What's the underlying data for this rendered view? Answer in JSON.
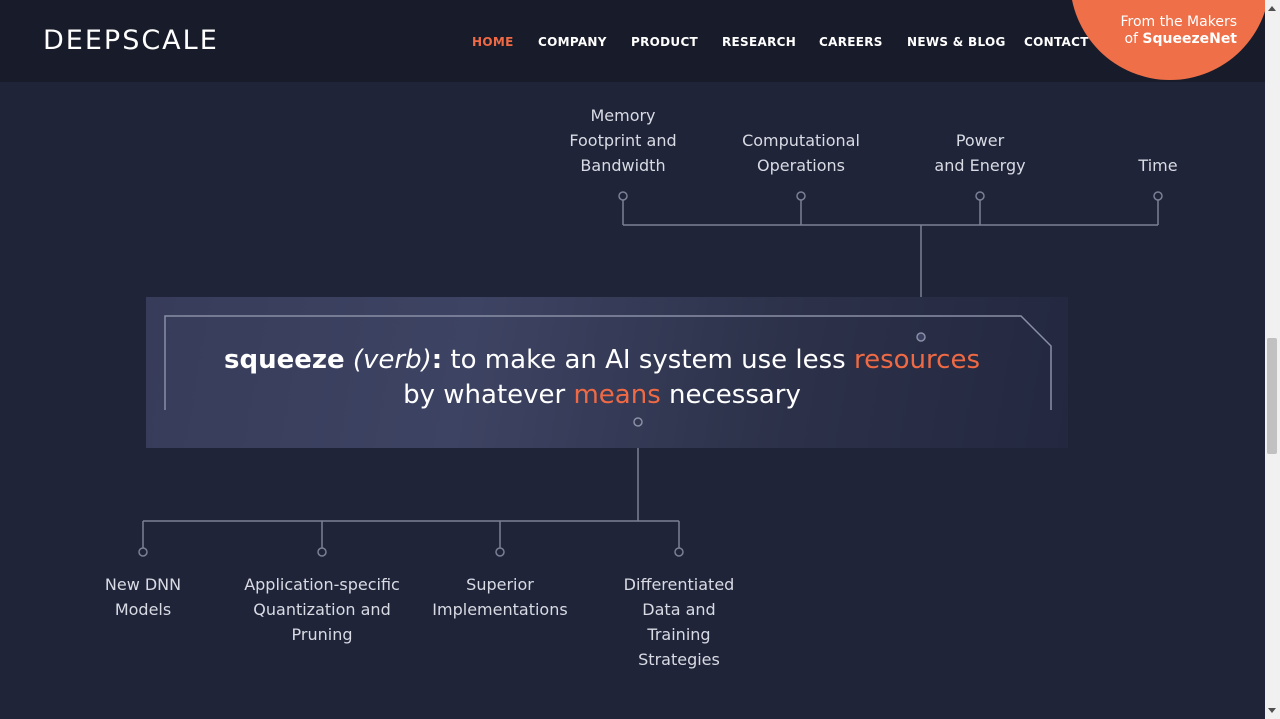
{
  "header": {
    "logo": "DEEPSCALE",
    "nav": [
      {
        "label": "HOME",
        "active": true
      },
      {
        "label": "COMPANY"
      },
      {
        "label": "PRODUCT"
      },
      {
        "label": "RESEARCH"
      },
      {
        "label": "CAREERS"
      },
      {
        "label": "NEWS & BLOG"
      },
      {
        "label": "CONTACT"
      }
    ],
    "badge": {
      "line1": "From the Makers",
      "line2_prefix": "of ",
      "line2_bold": "SqueezeNet"
    }
  },
  "top_labels": [
    {
      "lines": [
        "Memory",
        "Footprint and",
        "Bandwidth"
      ]
    },
    {
      "lines": [
        "Computational",
        "Operations"
      ]
    },
    {
      "lines": [
        "Power",
        "and Energy"
      ]
    },
    {
      "lines": [
        "Time"
      ]
    }
  ],
  "definition": {
    "word": "squeeze",
    "pos": "(verb)",
    "colon": ":",
    "text1": " to make an AI system use less ",
    "accent1": "resources",
    "text2": "by whatever ",
    "accent2": "means",
    "text3": " necessary"
  },
  "bottom_labels": [
    {
      "lines": [
        "New DNN",
        "Models"
      ]
    },
    {
      "lines": [
        "Application-specific",
        "Quantization and",
        "Pruning"
      ]
    },
    {
      "lines": [
        "Superior",
        "Implementations"
      ]
    },
    {
      "lines": [
        "Differentiated",
        "Data and",
        "Training",
        "Strategies"
      ]
    }
  ],
  "colors": {
    "accent": "#ef6a44",
    "background": "#1f2438",
    "header": "#181c2a"
  }
}
